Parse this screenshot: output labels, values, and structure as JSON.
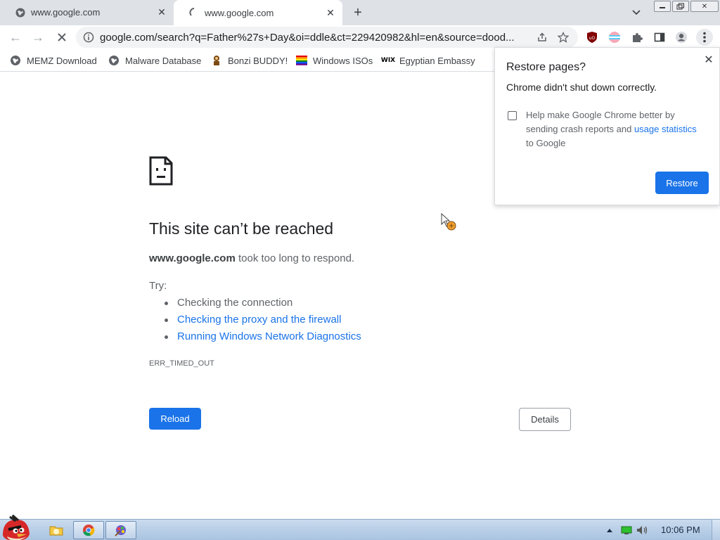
{
  "tabs": [
    {
      "title": "www.google.com",
      "active": false,
      "icon": "globe-icon"
    },
    {
      "title": "www.google.com",
      "active": true,
      "icon": "loading-spinner-icon"
    }
  ],
  "window_controls": {
    "minimize": "minimize-icon",
    "restore": "restore-icon",
    "close": "close-icon"
  },
  "omnibox": {
    "url": "google.com/search?q=Father%27s+Day&oi=ddle&ct=229420982&hl=en&source=dood..."
  },
  "bookmarks": [
    {
      "label": "MEMZ Download",
      "icon": "globe-icon"
    },
    {
      "label": "Malware Database",
      "icon": "globe-icon"
    },
    {
      "label": "Bonzi BUDDY!",
      "icon": "bonzi-icon"
    },
    {
      "label": "Windows ISOs",
      "icon": "rainbow-flag-icon"
    },
    {
      "label": "Egyptian Embassy",
      "icon": "wix-icon"
    }
  ],
  "error_page": {
    "title": "This site can’t be reached",
    "host": "www.google.com",
    "desc_rest": " took too long to respond.",
    "try_label": "Try:",
    "suggestions": [
      {
        "text": "Checking the connection",
        "link": false
      },
      {
        "text": "Checking the proxy and the firewall",
        "link": true
      },
      {
        "text": "Running Windows Network Diagnostics",
        "link": true
      }
    ],
    "error_code": "ERR_TIMED_OUT",
    "reload_label": "Reload",
    "details_label": "Details"
  },
  "restore_popup": {
    "title": "Restore pages?",
    "subtitle": "Chrome didn't shut down correctly.",
    "checkbox_text": "Help make Google Chrome better by sending crash reports and",
    "link_text": "usage statistics",
    "checkbox_tail": "to Google",
    "checked": false,
    "restore_label": "Restore"
  },
  "taskbar": {
    "clock": "10:06 PM",
    "items": [
      "folder-icon",
      "chrome-icon",
      "paint-icon"
    ]
  },
  "colors": {
    "accent": "#1a73e8",
    "tabstrip": "#dee1e6"
  }
}
